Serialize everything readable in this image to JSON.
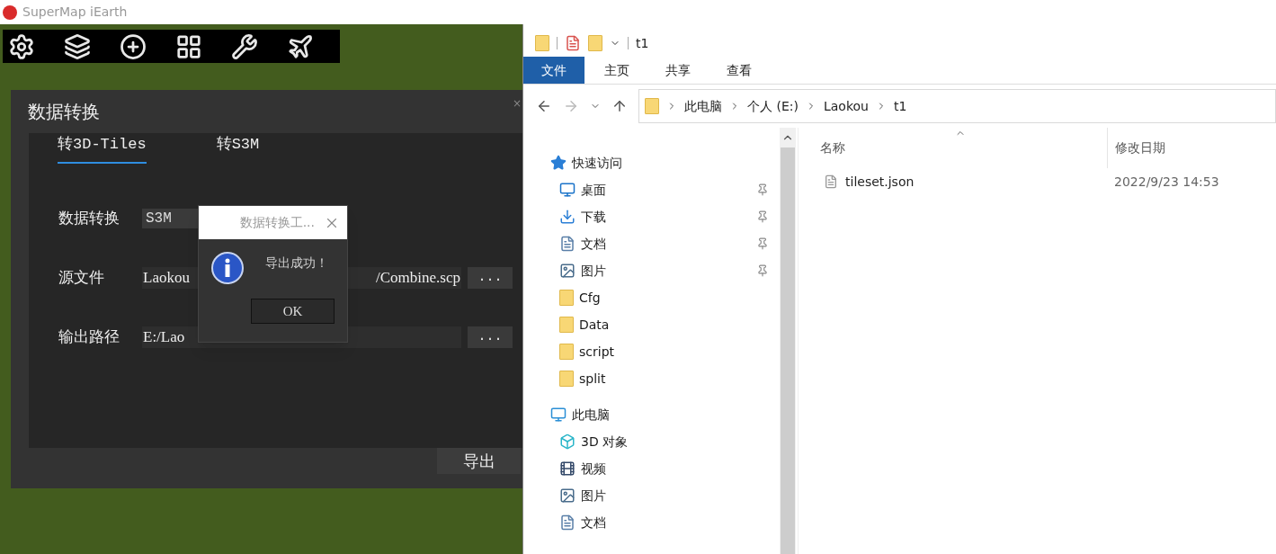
{
  "app": {
    "title": "SuperMap iEarth"
  },
  "convert_panel": {
    "title": "数据转换",
    "close": "×",
    "tabs": [
      {
        "label": "转3D-Tiles",
        "selected": true
      },
      {
        "label": "转S3M",
        "selected": false
      }
    ],
    "fields": [
      {
        "kind": "select",
        "label": "数据转换",
        "value": "S3M"
      },
      {
        "kind": "file",
        "label": "源文件",
        "value_start": "Laokou",
        "value_end": "/Combine.scp",
        "button": "..."
      },
      {
        "kind": "file",
        "label": "输出路径",
        "value_start": "E:/Lao",
        "button": "..."
      }
    ],
    "export_button": "导出"
  },
  "message_box": {
    "title": "数据转换工...",
    "message": "导出成功！",
    "button": "OK"
  },
  "explorer": {
    "title": "t1",
    "ribbon_tabs": [
      {
        "label": "文件",
        "selected": true
      },
      {
        "label": "主页",
        "selected": false
      },
      {
        "label": "共享",
        "selected": false
      },
      {
        "label": "查看",
        "selected": false
      }
    ],
    "breadcrumb": [
      "此电脑",
      "个人 (E:)",
      "Laokou",
      "t1"
    ],
    "nav": [
      {
        "kind": "star",
        "label": "快速访问",
        "children": [
          {
            "kind": "desktop",
            "label": "桌面",
            "pinned": true
          },
          {
            "kind": "download",
            "label": "下载",
            "pinned": true
          },
          {
            "kind": "document",
            "label": "文档",
            "pinned": true
          },
          {
            "kind": "picture",
            "label": "图片",
            "pinned": true
          },
          {
            "kind": "folder",
            "label": "Cfg",
            "pinned": false
          },
          {
            "kind": "folder",
            "label": "Data",
            "pinned": false
          },
          {
            "kind": "folder",
            "label": "script",
            "pinned": false
          },
          {
            "kind": "folder",
            "label": "split",
            "pinned": false
          }
        ]
      },
      {
        "kind": "computer",
        "label": "此电脑",
        "children": [
          {
            "kind": "cube",
            "label": "3D 对象",
            "pinned": false
          },
          {
            "kind": "video",
            "label": "视频",
            "pinned": false
          },
          {
            "kind": "picture",
            "label": "图片",
            "pinned": false
          },
          {
            "kind": "document",
            "label": "文档",
            "pinned": false
          }
        ]
      }
    ],
    "columns": [
      "名称",
      "修改日期"
    ],
    "files": [
      {
        "name": "tileset.json",
        "modified": "2022/9/23 14:53"
      }
    ]
  }
}
